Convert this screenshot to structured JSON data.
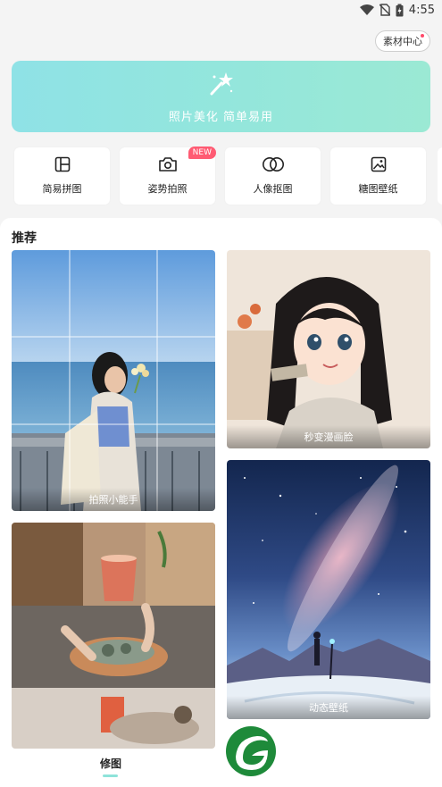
{
  "status_bar": {
    "time": "4:55",
    "icons": [
      "wifi-icon",
      "no-sim-icon",
      "battery-charging-icon"
    ]
  },
  "header": {
    "material_center_label": "素材中心",
    "material_center_has_dot": true
  },
  "hero": {
    "icon": "magic-wand-icon",
    "slogan": "照片美化 简单易用",
    "gradient_colors": [
      "#8fe2e6",
      "#9be9d4"
    ]
  },
  "tools": [
    {
      "label": "简易拼图",
      "icon": "collage-icon"
    },
    {
      "label": "姿势拍照",
      "icon": "camera-icon",
      "badge": "NEW"
    },
    {
      "label": "人像抠图",
      "icon": "overlap-circles-icon"
    },
    {
      "label": "糖图壁纸",
      "icon": "image-frame-icon"
    }
  ],
  "recommend": {
    "title": "推荐",
    "cards": [
      {
        "caption": "拍照小能手",
        "image": "girl-at-seaside-photo"
      },
      {
        "caption": "秒变漫画脸",
        "image": "anime-girl-portrait"
      },
      {
        "caption": "",
        "image": "drinks-and-food-collage"
      },
      {
        "caption": "动态壁纸",
        "image": "starry-sky-wallpaper"
      }
    ]
  },
  "bottom_nav": {
    "edit_tab_label": "修图",
    "accent_color": "#8ee3da",
    "logo": "green-leaf-logo"
  }
}
